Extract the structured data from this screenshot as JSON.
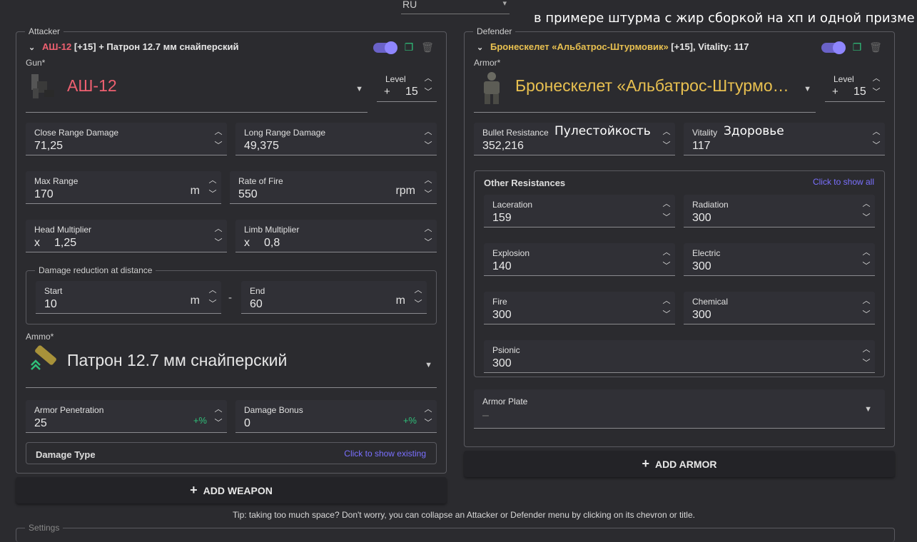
{
  "lang": {
    "value": "RU"
  },
  "annotation_note": "в примере штурма с жир сборкой на хп и одной призме",
  "attacker": {
    "legend": "Attacker",
    "title_name": "АШ-12",
    "title_level": " [+15]",
    "title_rest": " + Патрон 12.7 мм снайперский",
    "gun_label": "Gun*",
    "gun_name": "АШ-12",
    "level_label": "Level",
    "level_prefix": "+",
    "level_value": "15",
    "close_label": "Close Range Damage",
    "close_value": "71,25",
    "long_label": "Long Range Damage",
    "long_value": "49,375",
    "maxrange_label": "Max Range",
    "maxrange_value": "170",
    "maxrange_unit": "m",
    "rof_label": "Rate of Fire",
    "rof_value": "550",
    "rof_unit": "rpm",
    "head_label": "Head Multiplier",
    "head_prefix": "x",
    "head_value": "1,25",
    "limb_label": "Limb Multiplier",
    "limb_prefix": "x",
    "limb_value": "0,8",
    "dr_legend": "Damage reduction at distance",
    "start_label": "Start",
    "start_value": "10",
    "start_unit": "m",
    "dash": "-",
    "end_label": "End",
    "end_value": "60",
    "end_unit": "m",
    "ammo_label": "Ammo*",
    "ammo_name": "Патрон 12.7 мм снайперский",
    "ap_label": "Armor Penetration",
    "ap_value": "25",
    "ap_suffix": "+%",
    "db_label": "Damage Bonus",
    "db_value": "0",
    "db_suffix": "+%",
    "damage_type": "Damage Type",
    "show_existing": "Click to show existing"
  },
  "add_weapon": "ADD WEAPON",
  "defender": {
    "legend": "Defender",
    "title_name": "Бронескелет «Альбатрос-Штурмовик»",
    "title_rest": " [+15], Vitality: 117",
    "armor_label": "Armor*",
    "armor_name": "Бронескелет «Альбатрос-Штурмо…",
    "level_label": "Level",
    "level_prefix": "+",
    "level_value": "15",
    "bullet_label": "Bullet Resistance",
    "bullet_value": "352,216",
    "bullet_note": "Пулестойкость",
    "vit_label": "Vitality",
    "vit_value": "117",
    "vit_note": "Здоровье",
    "other_title": "Other Resistances",
    "show_all": "Click to show all",
    "laceration_label": "Laceration",
    "laceration_value": "159",
    "radiation_label": "Radiation",
    "radiation_value": "300",
    "explosion_label": "Explosion",
    "explosion_value": "140",
    "electric_label": "Electric",
    "electric_value": "300",
    "fire_label": "Fire",
    "fire_value": "300",
    "chemical_label": "Chemical",
    "chemical_value": "300",
    "psionic_label": "Psionic",
    "psionic_value": "300",
    "plate_label": "Armor Plate",
    "plate_value": "–"
  },
  "add_armor": "ADD ARMOR",
  "tip": "Tip: taking too much space? Don't worry, you can collapse an Attacker or Defender menu by clicking on its chevron or title.",
  "settings_legend": "Settings",
  "colors": {
    "accent": "#7a70ff",
    "green": "#2fc07a",
    "red": "#ee6070",
    "gold": "#e8c050"
  }
}
